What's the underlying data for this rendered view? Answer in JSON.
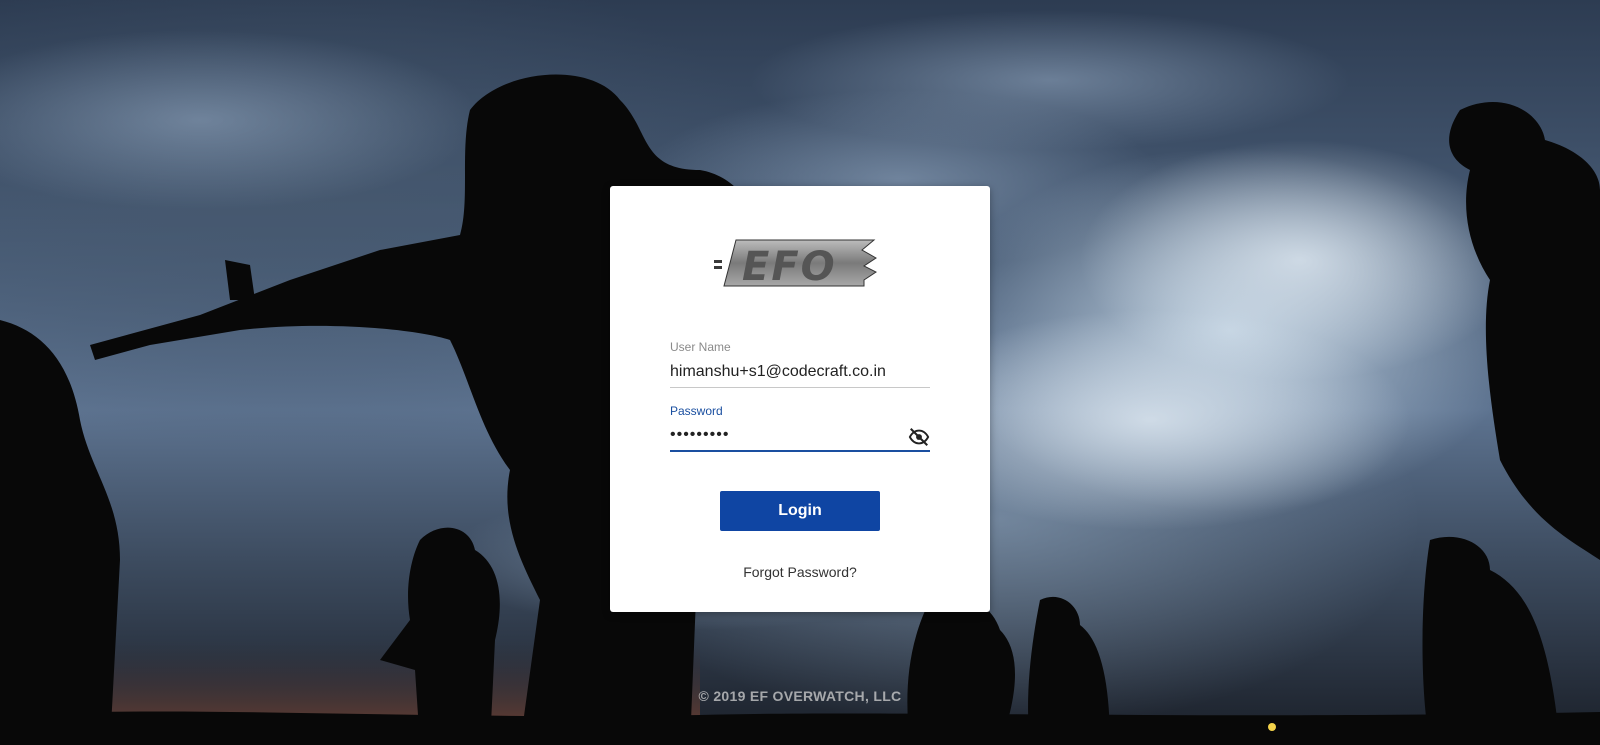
{
  "logo": {
    "text": "EFO",
    "icon": "efo-logo"
  },
  "login_form": {
    "username": {
      "label": "User Name",
      "value": "himanshu+s1@codecraft.co.in"
    },
    "password": {
      "label": "Password",
      "value": "•••••••••",
      "toggle_icon": "eye-off-icon"
    },
    "login_label": "Login",
    "forgot_label": "Forgot Password?"
  },
  "footer": {
    "copyright": "© 2019 EF OVERWATCH, LLC"
  },
  "colors": {
    "primary": "#0f45a3",
    "card_bg": "#ffffff",
    "label_active": "#1a4fa0"
  }
}
